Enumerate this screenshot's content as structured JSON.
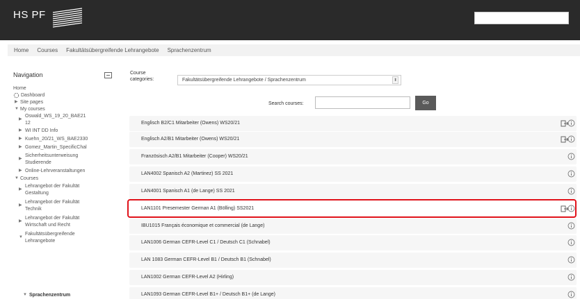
{
  "header": {
    "logo_text": "HS PF",
    "search_placeholder": ""
  },
  "breadcrumb": [
    "Home",
    "Courses",
    "Fakultätsübergreifende Lehrangebote",
    "Sprachenzentrum"
  ],
  "navigation": {
    "title": "Navigation",
    "home": "Home",
    "dashboard": "Dashboard",
    "site_pages": "Site pages",
    "my_courses": "My courses",
    "my_course_items": [
      "Oswald_WS_19_20_BAE21",
      "12",
      "WI INT DD Info",
      "Kuehn_20/21_WS_BAE2330",
      "Gomez_Martin_SpecificChal",
      "Sicherheitsunterweisung",
      "Studierende",
      "Online-Lehrveranstaltungen"
    ],
    "courses": "Courses",
    "course_categories": [
      "Lehrangebot der Fakultät",
      "Gestaltung",
      "Lehrangebot der Fakultät",
      "Technik",
      "Lehrangebot der Fakultät",
      "Wirtschaft und Recht",
      "Fakultätsübergreifende",
      "Lehrangebote",
      "Sprachenzentrum"
    ]
  },
  "category": {
    "label_line1": "Course",
    "label_line2": "categories:",
    "selected": "Fakultätsübergreifende Lehrangebote / Sprachenzentrum"
  },
  "search": {
    "label": "Search courses:",
    "value": "",
    "go_label": "Go"
  },
  "courses": [
    {
      "title": "Englisch B2/C1 Mitarbeiter (Owens) WS20/21",
      "enrol": true
    },
    {
      "title": "Englisch A2/B1 Mitarbeiter (Owens) WS20/21",
      "enrol": true
    },
    {
      "title": "Französisch A2/B1 Mitarbeiter (Cooper) WS20/21",
      "enrol": false
    },
    {
      "title": "LAN4002 Spanisch A2 (Martinez) SS 2021",
      "enrol": false
    },
    {
      "title": "LAN4001 Spanisch A1 (de Lange) SS 2021",
      "enrol": false
    },
    {
      "title": "LAN1101 Presemester German A1 (Bölling) SS2021",
      "enrol": true,
      "highlighted": true
    },
    {
      "title": "IBU1015 Français économique et commercial (de Lange)",
      "enrol": false
    },
    {
      "title": "LAN1006 German CEFR-Level C1 / Deutsch C1 (Schnabel)",
      "enrol": false
    },
    {
      "title": "LAN 1083 German CEFR-Level B1 / Deutsch B1 (Schnabel)",
      "enrol": false
    },
    {
      "title": "LAN1002 German CEFR-Level A2 (Hirling)",
      "enrol": false
    },
    {
      "title": "LAN1093 German CEFR-Level B1+ / Deutsch B1+ (de Lange)",
      "enrol": false
    }
  ],
  "colors": {
    "header_bg": "#2a2a2a",
    "highlight": "#e0121a",
    "go_button": "#5a5a5a"
  }
}
